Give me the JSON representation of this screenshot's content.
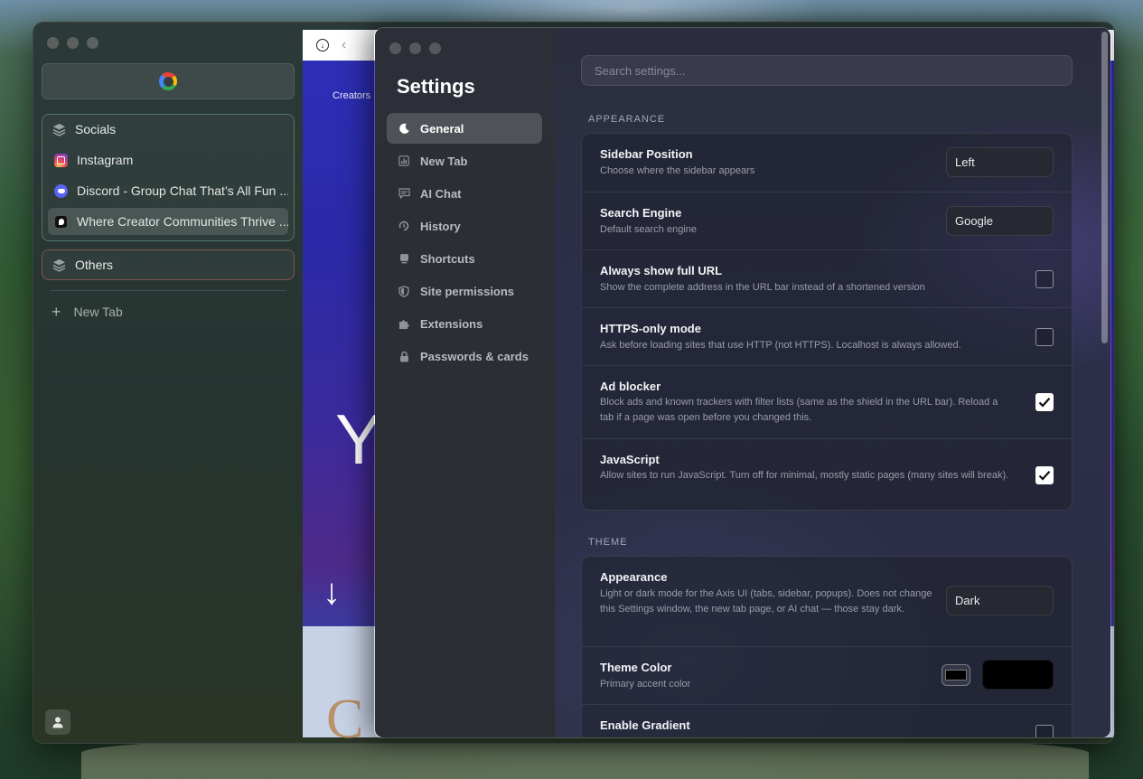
{
  "sidebar": {
    "groups": [
      {
        "name": "Socials",
        "tabs": [
          {
            "title": "Instagram",
            "favicon": "instagram-icon"
          },
          {
            "title": "Discord - Group Chat That’s All Fun ...",
            "favicon": "discord-icon"
          },
          {
            "title": "Where Creator Communities Thrive ...",
            "favicon": "patreon-icon",
            "active": true
          }
        ]
      },
      {
        "name": "Others",
        "tabs": []
      }
    ],
    "new_tab_label": "New Tab"
  },
  "web": {
    "creators_text": "Creators",
    "big_letter": "Y",
    "arrow": "↓",
    "bottom_letter": "C"
  },
  "settings": {
    "title": "Settings",
    "nav": [
      {
        "label": "General",
        "icon": "moon-icon",
        "active": true
      },
      {
        "label": "New Tab",
        "icon": "chart-icon"
      },
      {
        "label": "AI Chat",
        "icon": "chat-icon"
      },
      {
        "label": "History",
        "icon": "history-icon"
      },
      {
        "label": "Shortcuts",
        "icon": "keyboard-icon"
      },
      {
        "label": "Site permissions",
        "icon": "shield-icon"
      },
      {
        "label": "Extensions",
        "icon": "puzzle-icon"
      },
      {
        "label": "Passwords & cards",
        "icon": "lock-icon"
      }
    ],
    "search_placeholder": "Search settings...",
    "sections": {
      "appearance": {
        "label": "APPEARANCE",
        "rows": [
          {
            "title": "Sidebar Position",
            "desc": "Choose where the sidebar appears",
            "value": "Left"
          },
          {
            "title": "Search Engine",
            "desc": "Default search engine",
            "value": "Google"
          },
          {
            "title": "Always show full URL",
            "desc": "Show the complete address in the URL bar instead of a shortened version",
            "checked": false
          },
          {
            "title": "HTTPS-only mode",
            "desc": "Ask before loading sites that use HTTP (not HTTPS). Localhost is always allowed.",
            "checked": false
          },
          {
            "title": "Ad blocker",
            "desc": "Block ads and known trackers with filter lists (same as the shield in the URL bar). Reload a tab if a page was open before you changed this.",
            "checked": true
          },
          {
            "title": "JavaScript",
            "desc": "Allow sites to run JavaScript. Turn off for minimal, mostly static pages (many sites will break).",
            "checked": true
          }
        ]
      },
      "theme": {
        "label": "THEME",
        "rows": [
          {
            "title": "Appearance",
            "desc": "Light or dark mode for the Axis UI (tabs, sidebar, popups). Does not change this Settings window, the new tab page, or AI chat — those stay dark.",
            "value": "Dark"
          },
          {
            "title": "Theme Color",
            "desc": "Primary accent color",
            "color": "#000000"
          },
          {
            "title": "Enable Gradient",
            "checked": false
          }
        ]
      }
    }
  }
}
